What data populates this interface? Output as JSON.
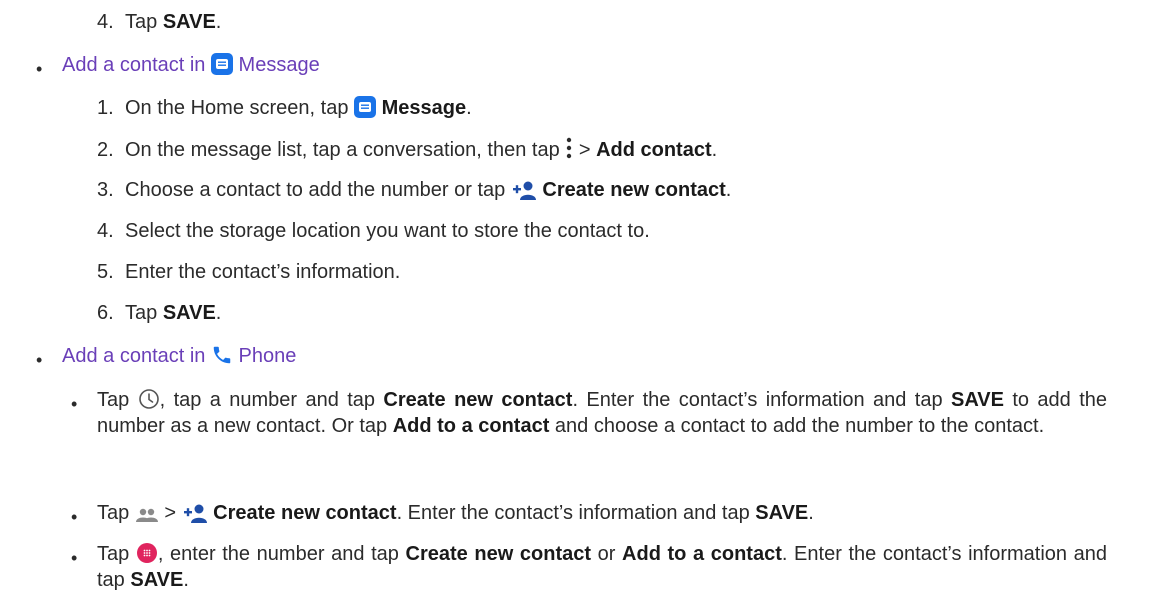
{
  "prev_step": {
    "num": "4.",
    "text_a": "Tap ",
    "bold": "SAVE",
    "text_b": "."
  },
  "sections": {
    "message": {
      "heading_pre": "Add a contact in ",
      "heading_app": "Message",
      "steps": [
        {
          "num": "1.",
          "a": "On the Home screen, tap ",
          "b": "Message",
          "c": "."
        },
        {
          "num": "2.",
          "a": "On the message list, tap a conversation, then tap ",
          "gt": " > ",
          "b": "Add contact",
          "c": "."
        },
        {
          "num": "3.",
          "a": "Choose a contact to add the number or tap ",
          "b": "Create new contact",
          "c": "."
        },
        {
          "num": "4.",
          "a": "Select the storage location you want to store the contact to."
        },
        {
          "num": "5.",
          "a": "Enter the contact’s information."
        },
        {
          "num": "6.",
          "a": "Tap ",
          "b": "SAVE",
          "c": "."
        }
      ]
    },
    "phone": {
      "heading_pre": "Add a contact in ",
      "heading_app": "Phone",
      "items": [
        {
          "a": "Tap ",
          "b": ", tap a number and tap ",
          "c": "Create new contact",
          "d": ". Enter the contact’s information and tap ",
          "e": "SAVE",
          "f": " to add the number as a new contact. Or tap ",
          "g": "Add to a contact",
          "h": " and choose a contact to add the number to the contact."
        },
        {
          "a": "Tap ",
          "gt": " > ",
          "b": "Create new contact",
          "c": ". Enter the contact’s information and tap ",
          "d": "SAVE",
          "e": "."
        },
        {
          "a": "Tap ",
          "b": ", enter the number and tap ",
          "c": "Create new contact",
          "d": " or ",
          "e": "Add to a contact",
          "f": ". Enter the contact’s information and tap ",
          "g": "SAVE",
          "h": "."
        }
      ]
    }
  },
  "icons": {
    "message": "message-app-icon",
    "phone": "phone-app-icon",
    "more": "more-vertical-icon",
    "add_contact": "add-contact-icon",
    "recents": "recents-clock-icon",
    "contacts": "contacts-people-icon",
    "dialpad": "dialpad-icon"
  },
  "colors": {
    "heading": "#6a3fb8",
    "message_icon": "#1a73e8",
    "phone_icon": "#1a73e8",
    "add_contact_icon": "#1f4ea8",
    "dialpad_icon": "#e0245e"
  }
}
